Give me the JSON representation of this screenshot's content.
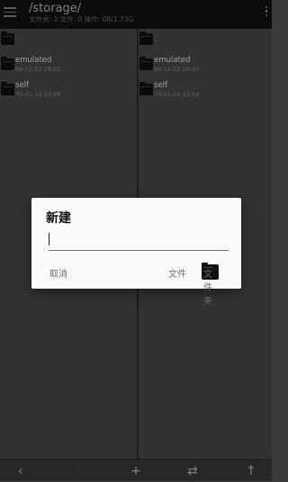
{
  "header": {
    "title": "/storage/",
    "subtitle": "文件夹: 3 文件: 0 操作: 0B/1.73G"
  },
  "left_pane": {
    "items": [
      {
        "name": "..",
        "date": ""
      },
      {
        "name": "emulated",
        "date": "69-12-22 18:03"
      },
      {
        "name": "self",
        "date": "70-01-19 22:48"
      }
    ]
  },
  "right_pane": {
    "items": [
      {
        "name": "..",
        "date": ""
      },
      {
        "name": "emulated",
        "date": "69-12-22 18:03"
      },
      {
        "name": "self",
        "date": "70-01-19 22:48"
      }
    ]
  },
  "bottom_bar": {
    "back": "‹",
    "forward": "›",
    "add": "+",
    "swap": "⇄",
    "up": "↑"
  },
  "dialog": {
    "title": "新建",
    "input_value": "",
    "cancel_label": "取消",
    "file_label": "文件",
    "folder_label": "文件夹"
  }
}
